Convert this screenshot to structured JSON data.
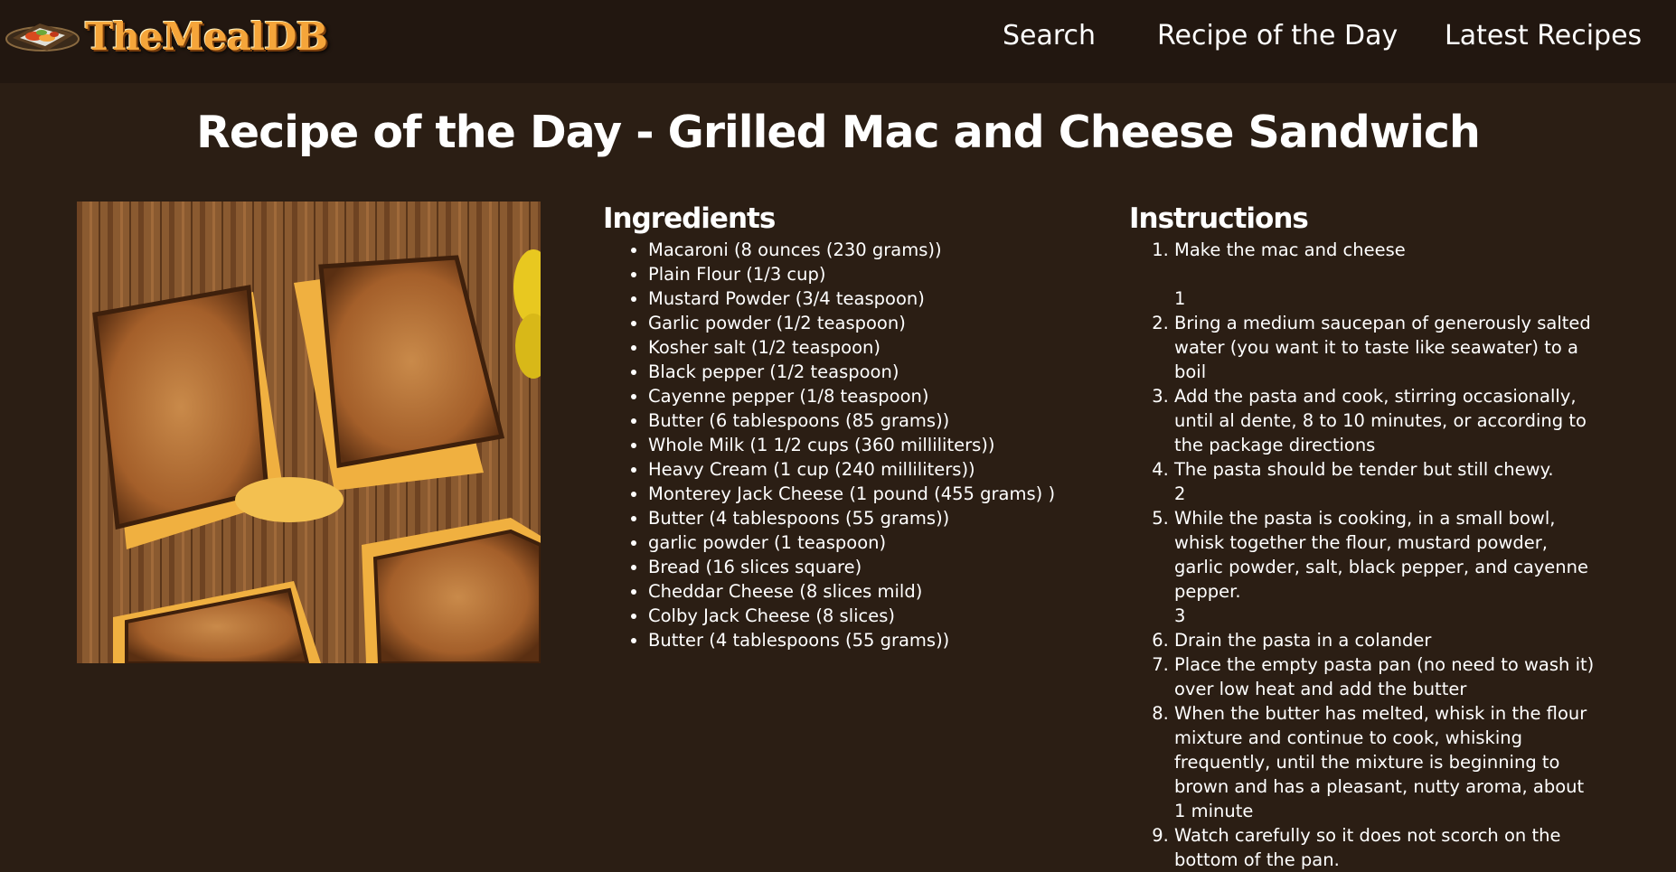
{
  "site": {
    "logo_text": "TheMealDB"
  },
  "nav": {
    "search": "Search",
    "recipe_of_day": "Recipe of the Day",
    "latest": "Latest Recipes"
  },
  "page": {
    "title": "Recipe of the Day - Grilled Mac and Cheese Sandwich"
  },
  "ingredients": {
    "heading": "Ingredients",
    "items": [
      "Macaroni (8 ounces (230 grams))",
      "Plain Flour (1/3 cup)",
      "Mustard Powder (3/4 teaspoon)",
      "Garlic powder (1/2 teaspoon)",
      "Kosher salt (1/2 teaspoon)",
      "Black pepper (1/2 teaspoon)",
      "Cayenne pepper (1/8 teaspoon)",
      "Butter (6 tablespoons (85 grams))",
      "Whole Milk (1 1/2 cups (360 milliliters))",
      "Heavy Cream (1 cup (240 milliliters))",
      "Monterey Jack Cheese (1 pound (455 grams) )",
      "Butter (4 tablespoons (55 grams))",
      "garlic powder (1 teaspoon)",
      "Bread (16 slices square)",
      "Cheddar Cheese (8 slices mild)",
      "Colby Jack Cheese (8 slices)",
      "Butter (4 tablespoons (55 grams))"
    ]
  },
  "instructions": {
    "heading": "Instructions",
    "steps": [
      "Make the mac and cheese\n\n1",
      "Bring a medium saucepan of generously salted water (you want it to taste like seawater) to a boil",
      "Add the pasta and cook, stirring occasionally, until al dente, 8 to 10 minutes, or according to the package directions",
      "The pasta should be tender but still chewy.\n2",
      "While the pasta is cooking, in a small bowl, whisk together the flour, mustard powder, garlic powder, salt, black pepper, and cayenne pepper.\n3",
      "Drain the pasta in a colander",
      "Place the empty pasta pan (no need to wash it) over low heat and add the butter",
      "When the butter has melted, whisk in the flour mixture and continue to cook, whisking frequently, until the mixture is beginning to brown and has a pleasant, nutty aroma, about 1 minute",
      "Watch carefully so it does not scorch on the bottom of the pan."
    ]
  }
}
